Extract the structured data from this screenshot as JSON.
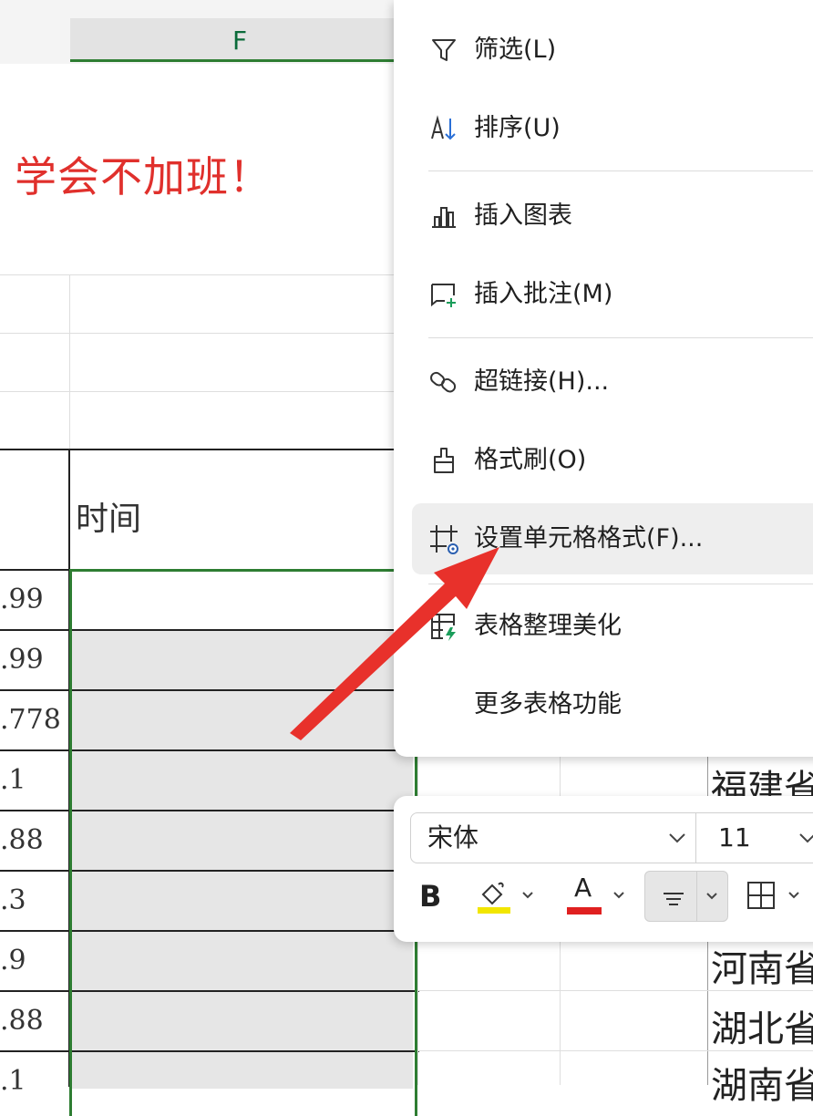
{
  "sheet": {
    "column_header": "F",
    "title_text": "学会不加班！",
    "header_cell": "时间",
    "number_cells": [
      ".99",
      ".99",
      ".778",
      ".1",
      ".88",
      ".3",
      ".9",
      ".88",
      ".1"
    ],
    "province_cells": [
      "福建省",
      "河南省",
      "湖北省",
      "湖南省"
    ],
    "accent_color": "#2e7d32",
    "title_color": "#e0302c"
  },
  "context_menu": {
    "items": [
      {
        "label": "筛选(L)",
        "icon": "filter-icon"
      },
      {
        "label": "排序(U)",
        "icon": "sort-icon"
      },
      {
        "label": "插入图表",
        "icon": "chart-icon"
      },
      {
        "label": "插入批注(M)",
        "icon": "comment-icon"
      },
      {
        "label": "超链接(H)...",
        "icon": "link-icon"
      },
      {
        "label": "格式刷(O)",
        "icon": "format-painter-icon"
      },
      {
        "label": "设置单元格格式(F)...",
        "icon": "cell-format-icon"
      },
      {
        "label": "表格整理美化",
        "icon": "table-beautify-icon"
      },
      {
        "label": "更多表格功能",
        "icon": ""
      }
    ],
    "highlighted_index": 6
  },
  "mini_toolbar": {
    "font_name": "宋体",
    "font_size": "11",
    "bold_label": "B",
    "font_color_label": "A",
    "highlight_color": "#f2e600",
    "font_color": "#e02020"
  }
}
